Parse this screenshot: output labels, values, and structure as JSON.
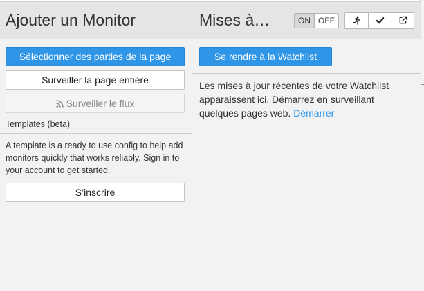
{
  "left_panel": {
    "title": "Ajouter un Monitor",
    "select_parts_label": "Sélectionner des parties de la page",
    "monitor_page_label": "Surveiller la page entière",
    "monitor_feed_label": "Surveiller le flux",
    "templates_heading": "Templates (beta)",
    "templates_description": "A template is a ready to use config to help add monitors quickly that works reliably. Sign in to your account to get started.",
    "signup_label": "S’inscrire"
  },
  "right_panel": {
    "title": "Mises à…",
    "toggle": {
      "on_label": "ON",
      "off_label": "OFF",
      "active": "ON"
    },
    "icons": [
      "running-icon",
      "check-icon",
      "external-link-icon"
    ],
    "watchlist_button_label": "Se rendre à la Watchlist",
    "updates_text": "Les mises à jour récentes de votre Watchlist apparaissent ici. Démarrez en surveillant quelques pages web.",
    "start_link_label": "Démarrer"
  },
  "colors": {
    "primary": "#2f95e6",
    "header_bg": "#e5e5e5",
    "panel_bg": "#f2f2f2"
  }
}
